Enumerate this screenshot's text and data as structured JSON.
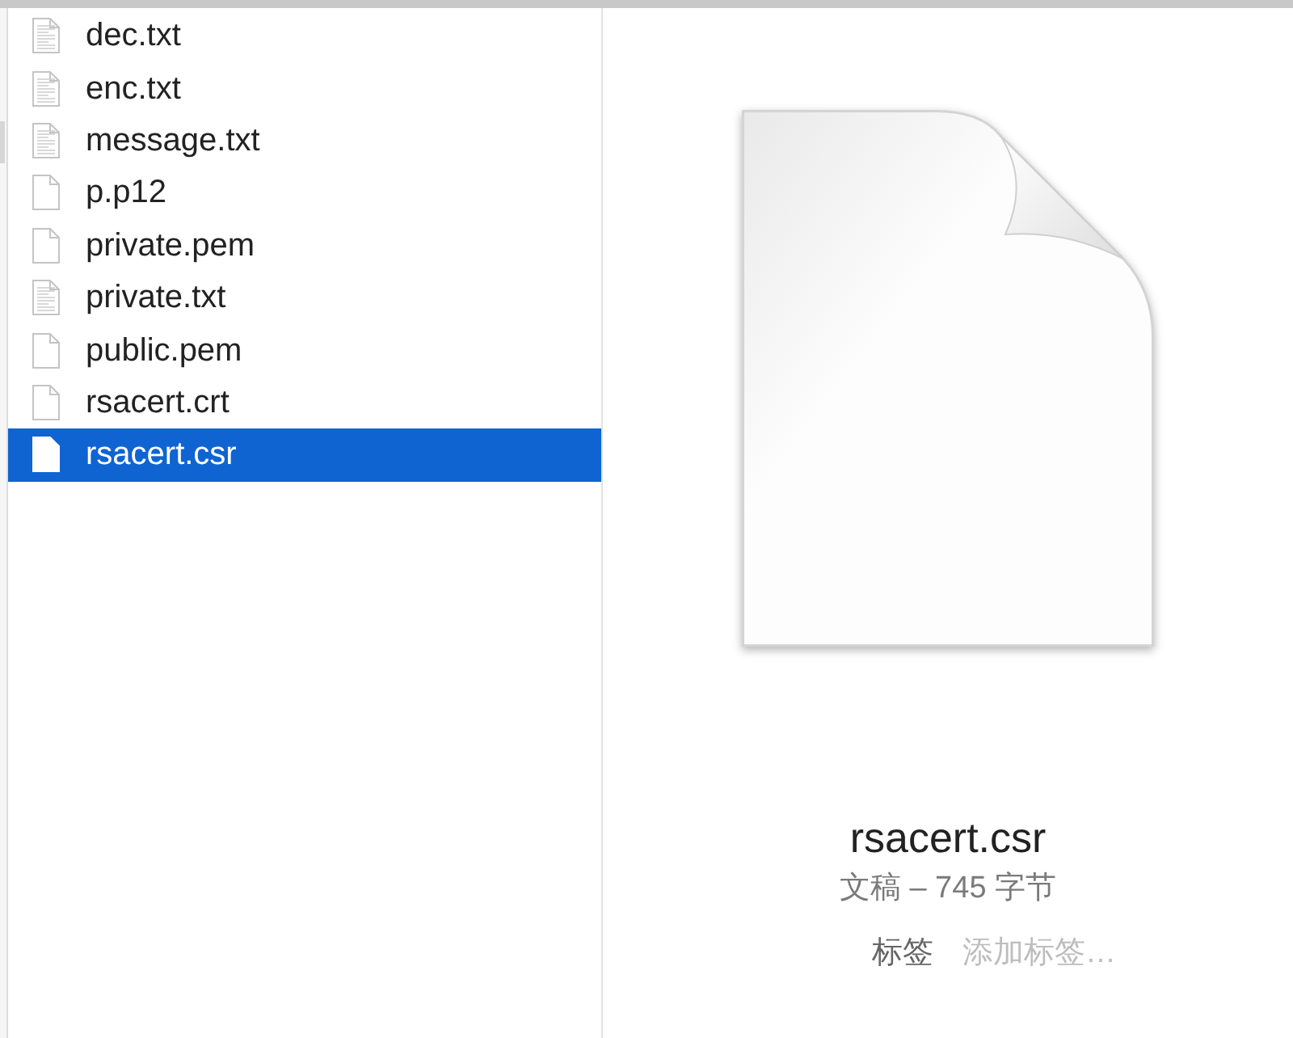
{
  "files": [
    {
      "name": "dec.txt",
      "kind": "text",
      "selected": false
    },
    {
      "name": "enc.txt",
      "kind": "text",
      "selected": false
    },
    {
      "name": "message.txt",
      "kind": "text",
      "selected": false
    },
    {
      "name": "p.p12",
      "kind": "blank",
      "selected": false
    },
    {
      "name": "private.pem",
      "kind": "blank",
      "selected": false
    },
    {
      "name": "private.txt",
      "kind": "text",
      "selected": false
    },
    {
      "name": "public.pem",
      "kind": "blank",
      "selected": false
    },
    {
      "name": "rsacert.crt",
      "kind": "blank",
      "selected": false
    },
    {
      "name": "rsacert.csr",
      "kind": "blank",
      "selected": true
    }
  ],
  "preview": {
    "name": "rsacert.csr",
    "info": "文稿 – 745 字节",
    "tags": {
      "label": "标签",
      "placeholder": "添加标签…"
    }
  }
}
